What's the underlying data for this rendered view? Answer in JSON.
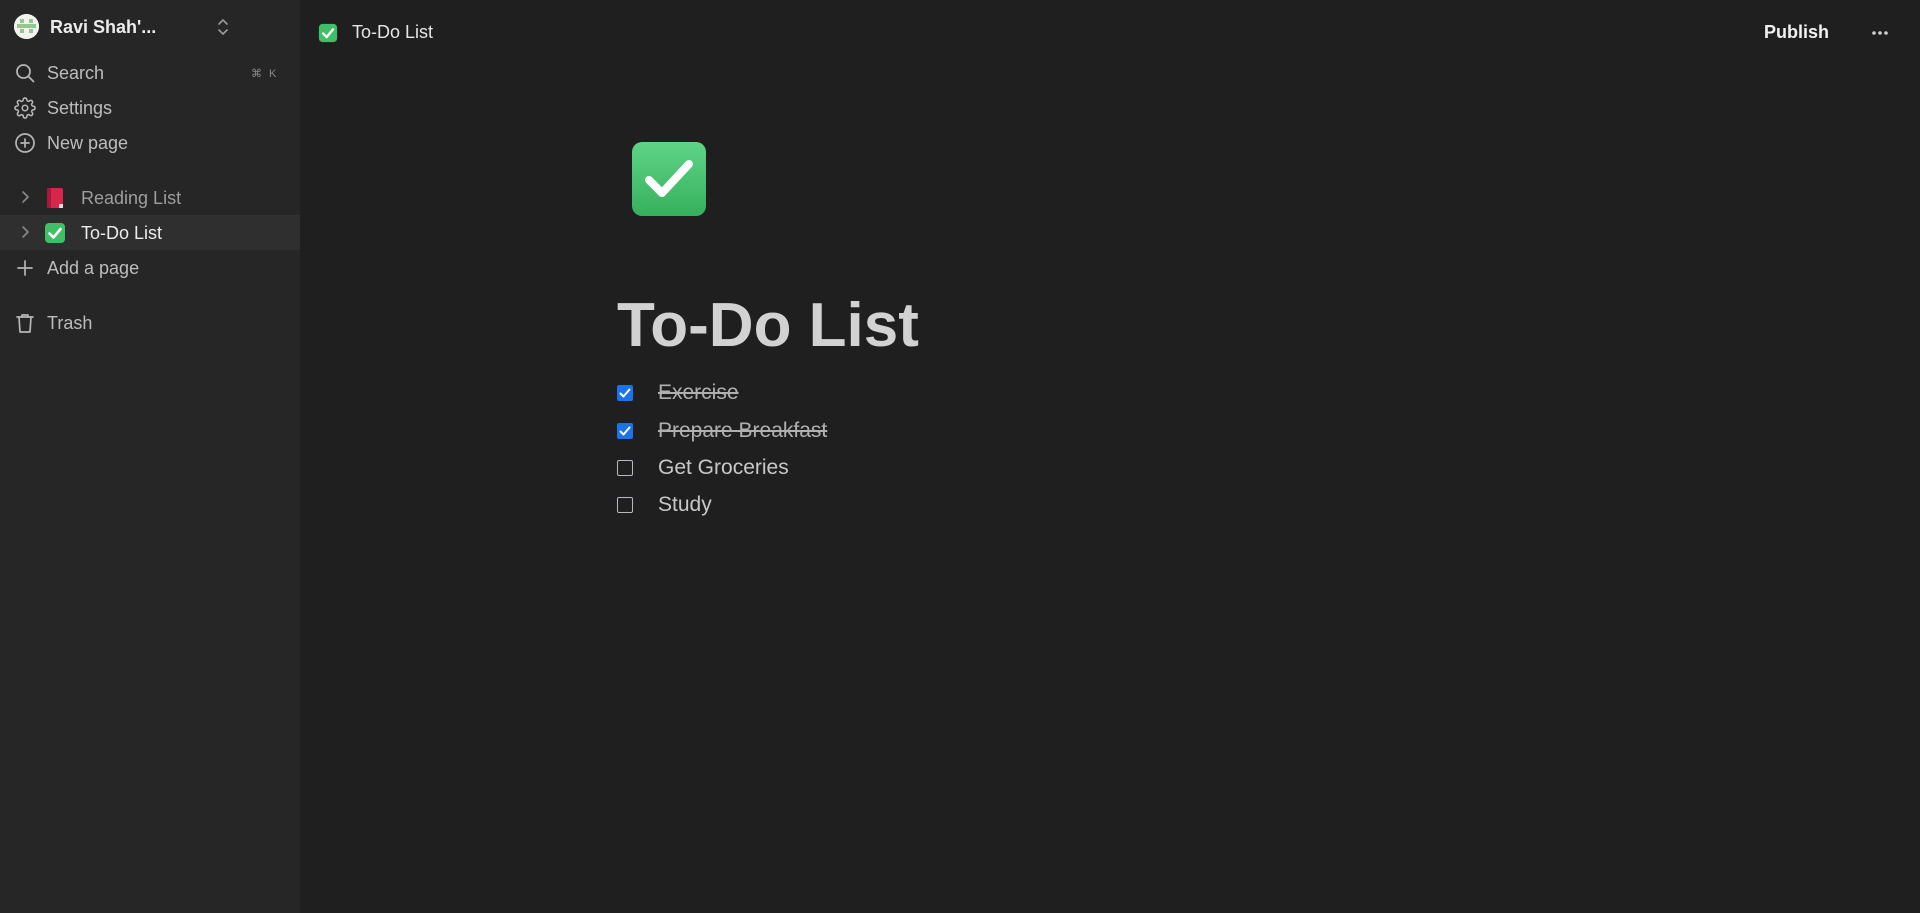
{
  "workspace": {
    "name": "Ravi Shah'...",
    "avatar_icon": "pixel-avatar-icon",
    "switch_icon": "chevron-up-down-icon"
  },
  "sidebar": {
    "nav": [
      {
        "label": "Search",
        "icon": "search-icon",
        "shortcut": "⌘ K"
      },
      {
        "label": "Settings",
        "icon": "gear-icon"
      },
      {
        "label": "New page",
        "icon": "plus-circle-icon"
      }
    ],
    "pages": [
      {
        "label": "Reading List",
        "icon": "closed-book-icon",
        "active": false
      },
      {
        "label": "To-Do List",
        "icon": "check-mark-button-icon",
        "active": true
      }
    ],
    "add_page_label": "Add a page",
    "trash_label": "Trash"
  },
  "topbar": {
    "breadcrumb_title": "To-Do List",
    "publish_label": "Publish",
    "more_icon": "ellipsis-icon"
  },
  "page": {
    "icon": "check-mark-button-icon",
    "title": "To-Do List",
    "todos": [
      {
        "text": "Exercise",
        "checked": true
      },
      {
        "text": "Prepare Breakfast",
        "checked": true
      },
      {
        "text": "Get Groceries",
        "checked": false
      },
      {
        "text": "Study",
        "checked": false
      }
    ]
  },
  "colors": {
    "background": "#1f1f1f",
    "sidebar": "#262626",
    "active_row": "#2f2f2f",
    "checkbox_checked": "#1a73e8",
    "emoji_green": "#3fbf67",
    "book_red": "#d6274a"
  }
}
